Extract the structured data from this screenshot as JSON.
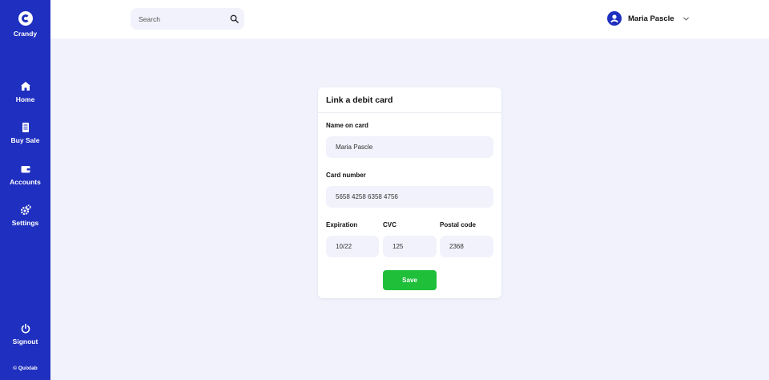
{
  "app": {
    "brand_name": "Crandy",
    "copyright": "© Quixlab"
  },
  "sidebar": {
    "items": [
      {
        "label": "Home",
        "icon": "home-icon"
      },
      {
        "label": "Buy Sale",
        "icon": "receipt-icon"
      },
      {
        "label": "Accounts",
        "icon": "wallet-icon"
      },
      {
        "label": "Settings",
        "icon": "gear-icon"
      }
    ],
    "signout": {
      "label": "Signout",
      "icon": "power-icon"
    }
  },
  "header": {
    "search": {
      "placeholder": "Search",
      "value": ""
    },
    "user": {
      "name": "Maria Pascle"
    }
  },
  "card": {
    "title": "Link a debit card",
    "name_on_card": {
      "label": "Name on card",
      "value": "Maria Pascle"
    },
    "card_number": {
      "label": "Card number",
      "value": "5658 4258 6358 4756"
    },
    "expiration": {
      "label": "Expiration",
      "value": "10/22"
    },
    "cvc": {
      "label": "CVC",
      "value": "125"
    },
    "postal_code": {
      "label": "Postal code",
      "value": "2368"
    },
    "save_label": "Save"
  },
  "colors": {
    "sidebar": "#1f2fbf",
    "background": "#f1f2fb",
    "save_button": "#1fbf3a"
  }
}
